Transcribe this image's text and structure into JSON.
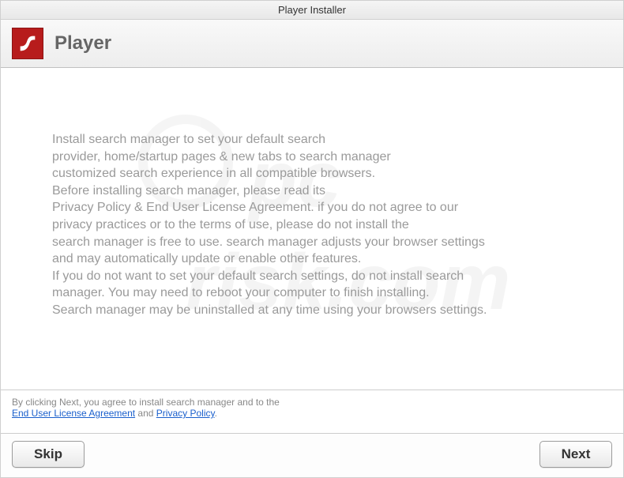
{
  "titlebar": {
    "title": "Player Installer"
  },
  "header": {
    "app_name": "Player"
  },
  "body": {
    "line1": "Install search manager to set your default search",
    "line2": "provider, home/startup pages & new tabs to search manager",
    "line3": "customized search experience in all compatible browsers.",
    "line4": "Before installing search manager, please read its",
    "line5": "Privacy Policy & End User License Agreement. if you do not agree to our",
    "line6": "privacy practices or to the terms of use, please do not install the",
    "line7": "search manager is free to use. search manager adjusts your browser settings",
    "line8": "and may automatically update or enable other features.",
    "line9": "If you do not want to set your default search settings, do not install search",
    "line10": "manager. You may need to reboot your computer to finish installing.",
    "line11": "Search manager may be uninstalled at any time using your browsers settings."
  },
  "agreement": {
    "prefix": "By clicking Next, you agree to install search manager and to the",
    "eula_link": "End User License Agreement",
    "and": " and ",
    "privacy_link": "Privacy Policy",
    "suffix": "."
  },
  "footer": {
    "skip_label": "Skip",
    "next_label": "Next"
  },
  "watermark": {
    "text1": "pc",
    "text2": "risk.com"
  }
}
